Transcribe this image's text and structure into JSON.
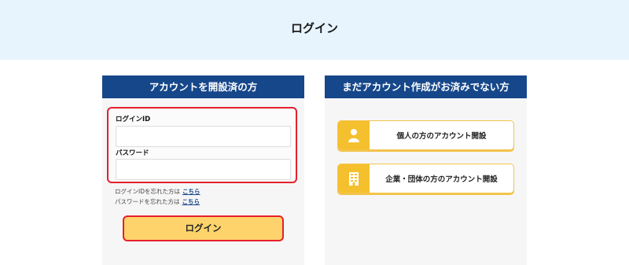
{
  "page": {
    "title": "ログイン"
  },
  "existing_account": {
    "header": "アカウントを開設済の方",
    "login_id": {
      "label": "ログインID",
      "value": "",
      "placeholder": ""
    },
    "password": {
      "label": "パスワード",
      "value": "",
      "placeholder": ""
    },
    "forgot_id": {
      "text": "ログインIDを忘れた方は",
      "link": "こちら"
    },
    "forgot_password": {
      "text": "パスワードを忘れた方は",
      "link": "こちら"
    },
    "login_button": "ログイン"
  },
  "new_account": {
    "header": "まだアカウント作成がお済みでない方",
    "personal": {
      "label": "個人の方のアカウント開設",
      "icon": "person-icon"
    },
    "corporate": {
      "label": "企業・団体の方のアカウント開設",
      "icon": "building-icon"
    }
  },
  "colors": {
    "top_band": "#e7f4fd",
    "header_navy": "#16478a",
    "highlight_red": "#e5202d",
    "button_yellow": "#ffd36b",
    "icon_yellow": "#f5c02e"
  }
}
